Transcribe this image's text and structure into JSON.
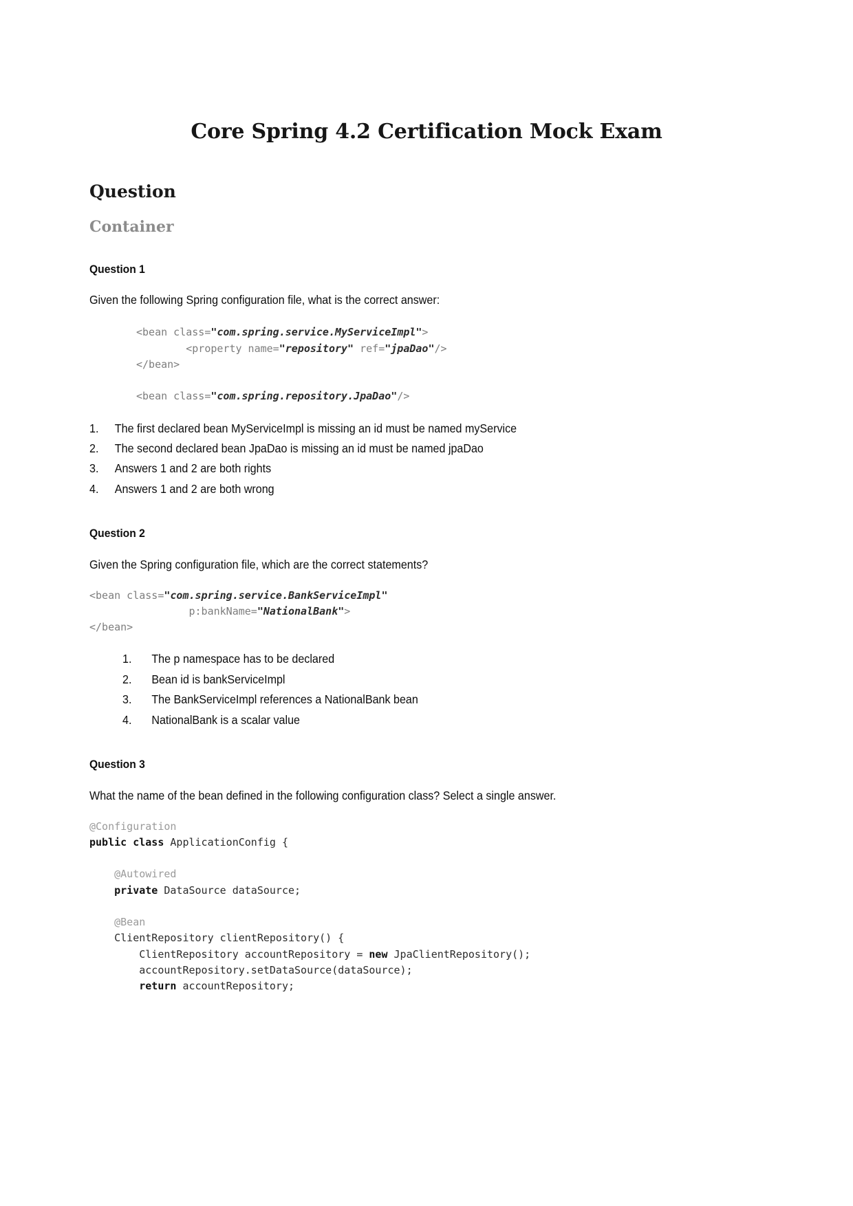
{
  "document": {
    "title": "Core Spring 4.2 Certification Mock Exam",
    "section_heading": "Question",
    "subsection_heading": "Container"
  },
  "questions": [
    {
      "heading": "Question 1",
      "prompt": "Given the following Spring configuration file, what is the correct answer:",
      "code_lines": [
        "<bean class=\"com.spring.service.MyServiceImpl\">",
        "        <property name=\"repository\" ref=\"jpaDao\"/>",
        "</bean>",
        "",
        "<bean class=\"com.spring.repository.JpaDao\"/>"
      ],
      "code_segments_1": {
        "t1": "<bean class=",
        "s1": "\"com.spring.service.MyServiceImpl\"",
        "t2": ">"
      },
      "code_segments_2": {
        "t1": "        <property name=",
        "s1": "\"repository\"",
        "t2": " ref=",
        "s2": "\"jpaDao\"",
        "t3": "/>"
      },
      "code_segments_3": {
        "t1": "</bean>"
      },
      "code_segments_4": {
        "t1": "<bean class=",
        "s1": "\"com.spring.repository.JpaDao\"",
        "t2": "/>"
      },
      "options": [
        {
          "num": "1.",
          "text": "The first declared bean MyServiceImpl is missing an id must be named myService"
        },
        {
          "num": "2.",
          "text": "The second declared bean JpaDao is missing an id must be named jpaDao"
        },
        {
          "num": "3.",
          "text": "Answers 1 and 2 are both rights"
        },
        {
          "num": "4.",
          "text": "Answers 1 and 2 are both wrong"
        }
      ]
    },
    {
      "heading": "Question 2",
      "prompt": "Given the Spring configuration file, which are the correct statements?",
      "code_segments_1": {
        "t1": "<bean class=",
        "s1": "\"com.spring.service.BankServiceImpl\""
      },
      "code_segments_2": {
        "t1": "                p:bankName=",
        "s1": "\"NationalBank\"",
        "t2": ">"
      },
      "code_segments_3": {
        "t1": "</bean>"
      },
      "options": [
        {
          "num": "1.",
          "text": "The p namespace has to be declared"
        },
        {
          "num": "2.",
          "text": "Bean id is bankServiceImpl"
        },
        {
          "num": "3.",
          "text": "The BankServiceImpl references a NationalBank bean"
        },
        {
          "num": "4.",
          "text": "NationalBank is a scalar value"
        }
      ]
    },
    {
      "heading": "Question 3",
      "prompt": "What the name of the bean defined in the following configuration class? Select a single answer.",
      "java": {
        "l1_ann": "@Configuration",
        "l2_kw": "public class",
        "l2_id": " ApplicationConfig {",
        "l3_ann": "    @Autowired",
        "l4_kw": "    private",
        "l4_id": " DataSource dataSource;",
        "l5_ann": "    @Bean",
        "l6_id": "    ClientRepository clientRepository() {",
        "l7a_id": "        ClientRepository accountRepository = ",
        "l7b_kw": "new",
        "l7c_id": " JpaClientRepository();",
        "l8_id": "        accountRepository.setDataSource(dataSource);",
        "l9a_kw": "        return",
        "l9b_id": " accountRepository;"
      }
    }
  ]
}
